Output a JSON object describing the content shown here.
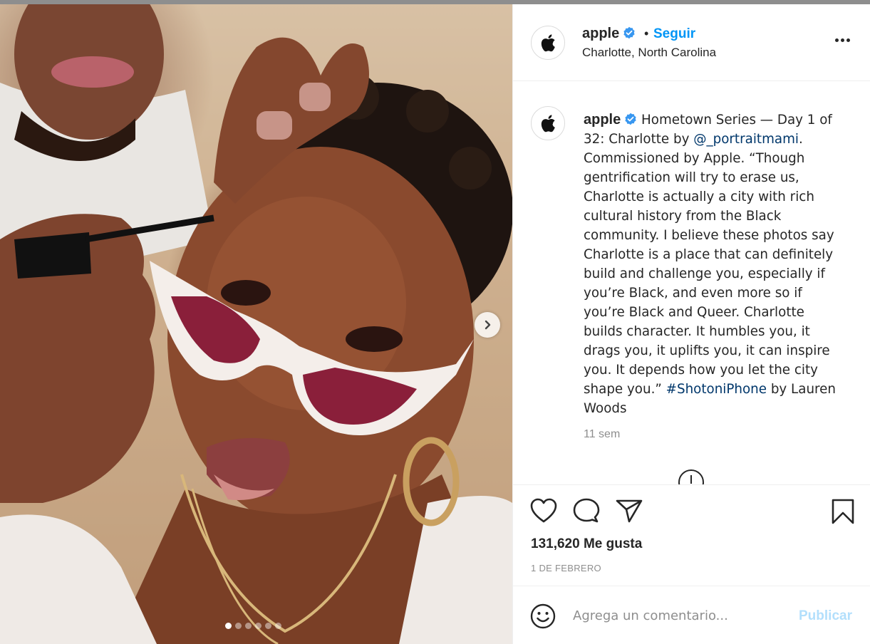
{
  "post": {
    "username": "apple",
    "follow_label": "Seguir",
    "separator": "•",
    "location": "Charlotte, North Carolina",
    "caption_parts": [
      " Hometown Series — Day 1 of 32: Charlotte by ",
      "@_portraitmami",
      ". Commissioned by Apple. “Though gentrification will try to erase us, Charlotte is actually a city with rich cultural history from the Black community. I believe these photos say Charlotte is a place that can definitely build and challenge you, especially if you’re Black, and even more so if you’re Black and Queer. Charlotte builds character. It humbles you, it drags you, it uplifts you, it can inspire you. It depends how you let the city shape you.” ",
      "#ShotoniPhone",
      " by Lauren Woods"
    ],
    "time_ago": "11 sem",
    "likes": "131,620 Me gusta",
    "date": "1 DE FEBRERO"
  },
  "carousel": {
    "total": 6,
    "active_index": 0
  },
  "comment": {
    "placeholder": "Agrega un comentario...",
    "publish_label": "Publicar"
  },
  "icons": {
    "avatar": "apple-logo-icon",
    "verified": "verified-badge-icon",
    "more": "more-options-icon",
    "like": "heart-icon",
    "comment": "comment-bubble-icon",
    "share": "paper-plane-icon",
    "save": "bookmark-icon",
    "emoji": "smiley-icon",
    "next": "chevron-right-icon"
  },
  "colors": {
    "link": "#00376b",
    "accent": "#0095f6",
    "verified": "#3897f0",
    "muted": "#8e8e8e",
    "publish_disabled": "#b2dffc"
  }
}
